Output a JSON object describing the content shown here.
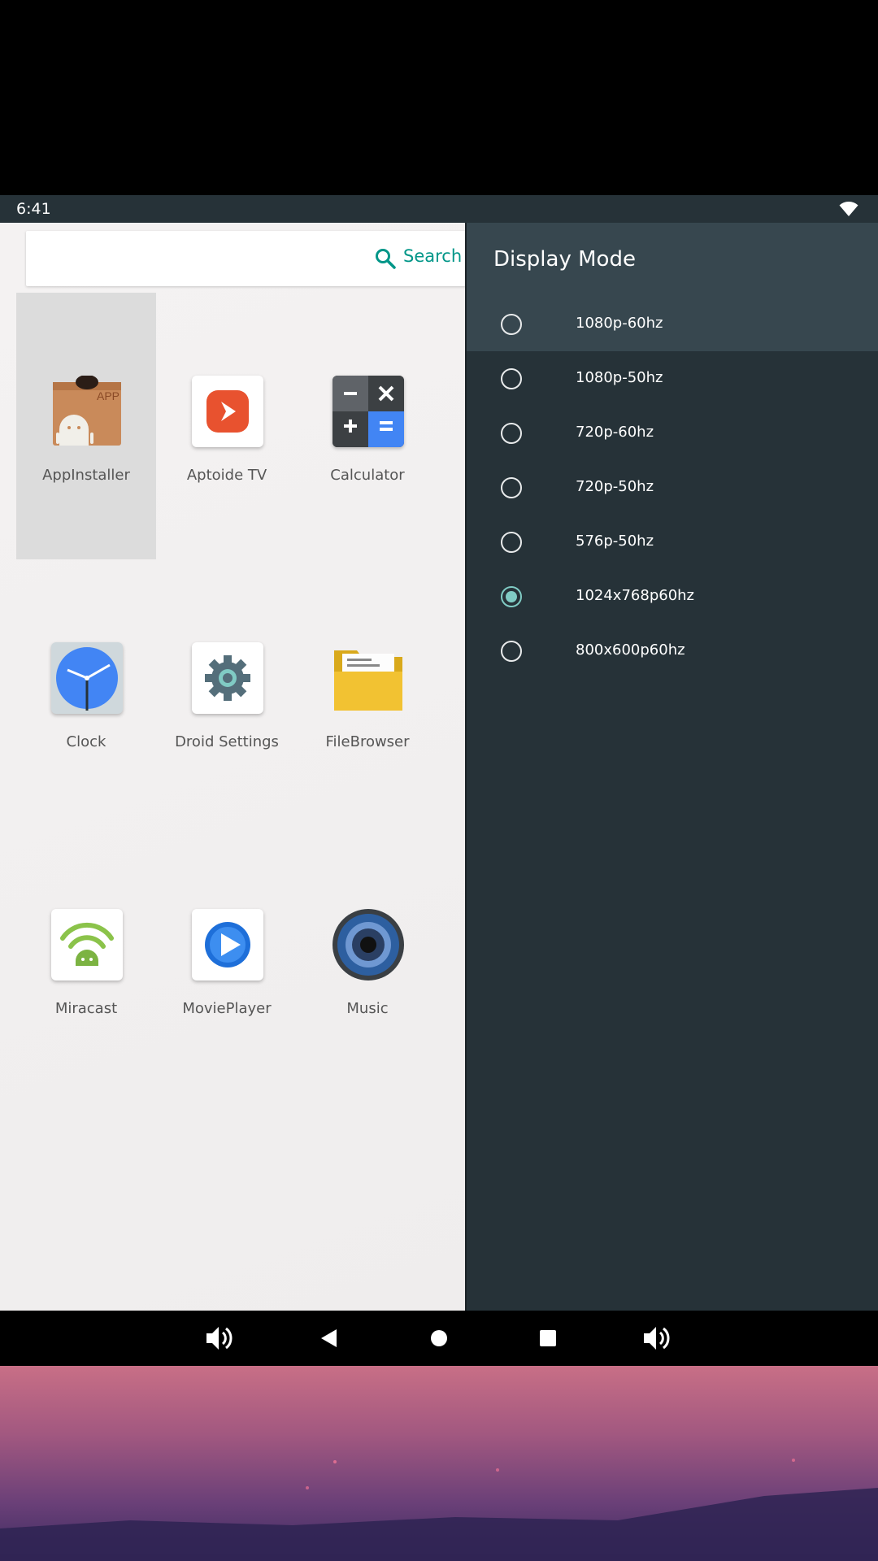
{
  "status_bar": {
    "time": "6:41"
  },
  "search": {
    "label": "Search a"
  },
  "apps": [
    {
      "label": "AppInstaller",
      "icon": "appinstaller-icon",
      "selected": true
    },
    {
      "label": "Aptoide TV",
      "icon": "aptoide-tv-icon"
    },
    {
      "label": "Calculator",
      "icon": "calculator-icon"
    },
    {
      "label": "Clock",
      "icon": "clock-icon"
    },
    {
      "label": "Droid Settings",
      "icon": "settings-gear-icon"
    },
    {
      "label": "FileBrowser",
      "icon": "folder-icon"
    },
    {
      "label": "Miracast",
      "icon": "miracast-icon"
    },
    {
      "label": "MoviePlayer",
      "icon": "movie-player-icon"
    },
    {
      "label": "Music",
      "icon": "speaker-icon"
    }
  ],
  "display_mode": {
    "title": "Display Mode",
    "options": [
      {
        "label": "1080p-60hz",
        "checked": false,
        "highlighted": true
      },
      {
        "label": "1080p-50hz",
        "checked": false
      },
      {
        "label": "720p-60hz",
        "checked": false
      },
      {
        "label": "720p-50hz",
        "checked": false
      },
      {
        "label": "576p-50hz",
        "checked": false
      },
      {
        "label": "1024x768p60hz",
        "checked": true
      },
      {
        "label": "800x600p60hz",
        "checked": false
      }
    ]
  },
  "colors": {
    "panel_bg": "#263238",
    "panel_header": "#37474f",
    "accent": "#80cbc4",
    "search_accent": "#009688"
  }
}
